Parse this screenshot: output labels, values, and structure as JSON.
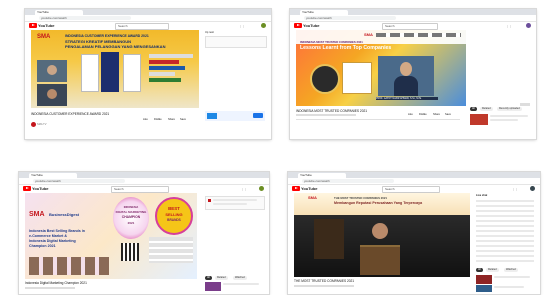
{
  "shots": [
    {
      "tab_title": "YouTube",
      "url": "youtube.com/watch",
      "search_placeholder": "Search",
      "brand_sm": "SMA",
      "banner_subtitle": "INDONESIA CUSTOMER EXPERIENCE AWARD 2021",
      "banner_title_1": "STRATEGI KREATIF MEMBANGUN",
      "banner_title_2": "PENGALAMAN PELANGGAN YANG MENGESANKAN",
      "video_title": "INDONESIA CUSTOMER EXPERIENCE AWARD 2021",
      "sidebar_heading": "Up next",
      "actions": [
        "Like",
        "Dislike",
        "Share",
        "Save"
      ],
      "channel": "SMA TV"
    },
    {
      "tab_title": "YouTube",
      "url": "youtube.com/watch",
      "search_placeholder": "Search",
      "brand_sm": "SMA",
      "banner_line_1": "INDONESIA MOST TRUSTED COMPANIES 2021",
      "banner_title": "Lessons Learnt from Top Companies",
      "speaker_caption": "PROF. GATOT NAZIR AHMAD, S.Si., M.Si.",
      "video_title": "INDONESIA MOST TRUSTED COMPANIES 2021",
      "actions": [
        "Like",
        "Dislike",
        "Share",
        "Save"
      ],
      "chips": [
        "All",
        "Related",
        "Recently uploaded",
        "Watched"
      ]
    },
    {
      "tab_title": "YouTube",
      "url": "youtube.com/watch",
      "search_placeholder": "Search",
      "brand_sm": "SMA",
      "partner": "BusinessDigest",
      "award_title_1": "INDONESIA",
      "award_title_2": "DIGITAL MARKETING",
      "award_title_3": "CHAMPION",
      "award_year": "2021",
      "badge_1": "BEST",
      "badge_2": "SELLING",
      "badge_3": "BRANDS",
      "headline_1": "Indonesia Best Selling Brands in",
      "headline_2": "e-Commerce Market &",
      "headline_3": "Indonesia Digital Marketing",
      "headline_4": "Champion 2021",
      "video_title": "Indonesia Digital Marketing Champion 2021",
      "chips": [
        "All",
        "Related",
        "Watched"
      ]
    },
    {
      "tab_title": "YouTube",
      "url": "youtube.com/watch",
      "search_placeholder": "Search",
      "brand_sm": "SMA",
      "banner_line_1": "THE MOST TRUSTED COMPANIES 2021",
      "banner_title": "Membangun Reputasi Perusahaan Yang Terpercaya",
      "video_title": "THE MOST TRUSTED COMPANIES 2021",
      "live_chat": "Live chat",
      "chips": [
        "All",
        "Related",
        "Watched"
      ]
    }
  ]
}
